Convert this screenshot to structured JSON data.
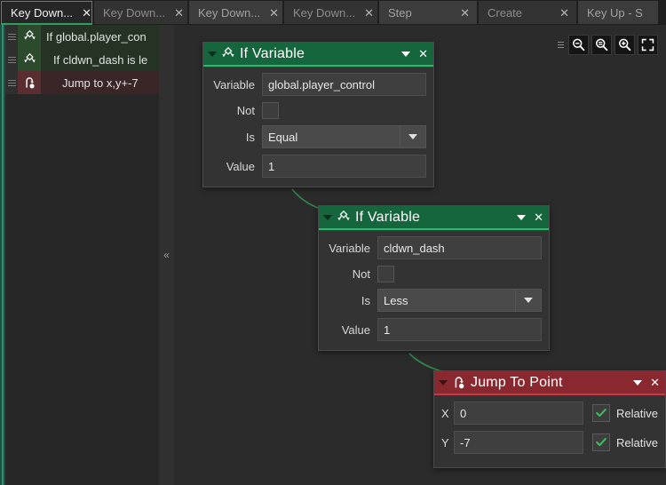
{
  "tabs": [
    {
      "label": "Key Down...",
      "close": "✕",
      "active": true
    },
    {
      "label": "Key Down...",
      "close": "✕",
      "active": false
    },
    {
      "label": "Key Down...",
      "close": "✕",
      "active": false
    },
    {
      "label": "Key Down...",
      "close": "✕",
      "active": false
    },
    {
      "label": "Step",
      "close": "✕",
      "active": false
    },
    {
      "label": "Create",
      "close": "✕",
      "active": false
    },
    {
      "label": "Key Up - S",
      "close": "",
      "active": false
    }
  ],
  "tree": {
    "items": [
      {
        "label": "If global.player_con",
        "icon": "if-variable-icon",
        "kind": "green",
        "indent": 0
      },
      {
        "label": "If cldwn_dash is le",
        "icon": "if-variable-icon",
        "kind": "green",
        "indent": 1
      },
      {
        "label": "Jump to x,y+-7",
        "icon": "jump-to-point-icon",
        "kind": "red",
        "indent": 2
      }
    ]
  },
  "collapse_handle": "«",
  "toolbar": {
    "buttons": [
      {
        "name": "zoom-out-icon",
        "label": "−"
      },
      {
        "name": "zoom-reset-icon",
        "label": "="
      },
      {
        "name": "zoom-in-icon",
        "label": "+"
      },
      {
        "name": "fit-to-screen-icon",
        "label": "⛶"
      }
    ]
  },
  "nodes": {
    "if_variable_1": {
      "title": "If Variable",
      "icon": "if-variable-icon",
      "close": "✕",
      "fields": {
        "variable_label": "Variable",
        "variable_value": "global.player_control",
        "not_label": "Not",
        "not_checked": false,
        "is_label": "Is",
        "is_value": "Equal",
        "value_label": "Value",
        "value_value": "1"
      }
    },
    "if_variable_2": {
      "title": "If Variable",
      "icon": "if-variable-icon",
      "close": "✕",
      "fields": {
        "variable_label": "Variable",
        "variable_value": "cldwn_dash",
        "not_label": "Not",
        "not_checked": false,
        "is_label": "Is",
        "is_value": "Less",
        "value_label": "Value",
        "value_value": "1"
      }
    },
    "jump_to_point": {
      "title": "Jump To Point",
      "icon": "jump-to-point-icon",
      "close": "✕",
      "fields": {
        "x_label": "X",
        "x_value": "0",
        "x_relative_label": "Relative",
        "x_relative_checked": true,
        "y_label": "Y",
        "y_value": "-7",
        "y_relative_label": "Relative",
        "y_relative_checked": true
      }
    }
  },
  "colors": {
    "accent_green": "#21c06e",
    "header_green": "#15663c",
    "header_red": "#8a2830",
    "accent_red": "#c23a43",
    "canvas_bg": "#2b2b2b",
    "wire": "#2f8a4e"
  }
}
